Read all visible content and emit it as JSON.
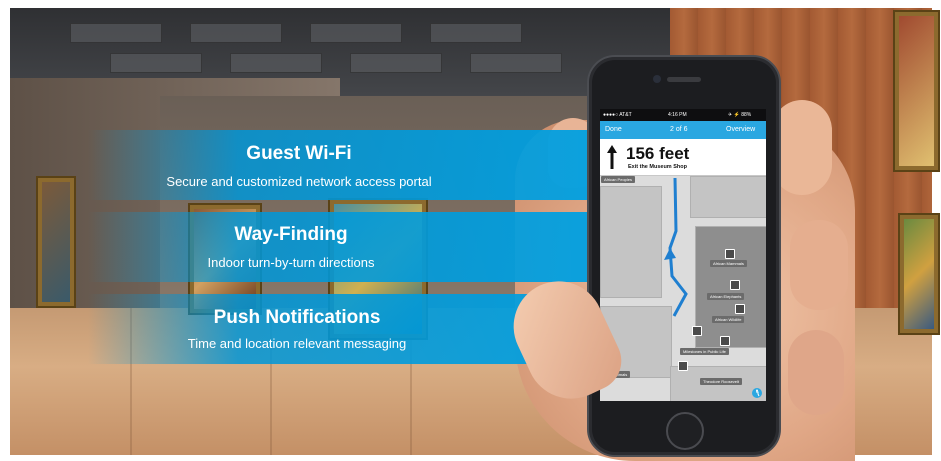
{
  "banners": {
    "wifi": {
      "title": "Guest Wi-Fi",
      "subtitle": "Secure and customized network access portal"
    },
    "wayfinding": {
      "title": "Way-Finding",
      "subtitle": "Indoor turn-by-turn directions"
    },
    "push": {
      "title": "Push Notifications",
      "subtitle": "Time and location relevant messaging"
    }
  },
  "phone": {
    "status": {
      "carrier": "●●●●○ AT&T",
      "time": "4:16 PM",
      "battery": "✈ ⚡ 88%"
    },
    "nav": {
      "done": "Done",
      "step": "2 of 6",
      "overview": "Overview"
    },
    "direction": {
      "distance": "156 feet",
      "instruction": "Exit the Museum Shop"
    },
    "map_labels": {
      "african_peoples": "African Peoples",
      "african_mammals": "African Mammals",
      "african_elephants": "African Elephants",
      "african_wildlife": "African Wildlife",
      "milestones": "Milestones in Public Life",
      "animals": "Animals",
      "theodore": "Theodore Roosevelt"
    }
  },
  "colors": {
    "banner_blue": "#00a0e1",
    "nav_blue": "#2aa7e1",
    "route_blue": "#1f7fd0"
  }
}
